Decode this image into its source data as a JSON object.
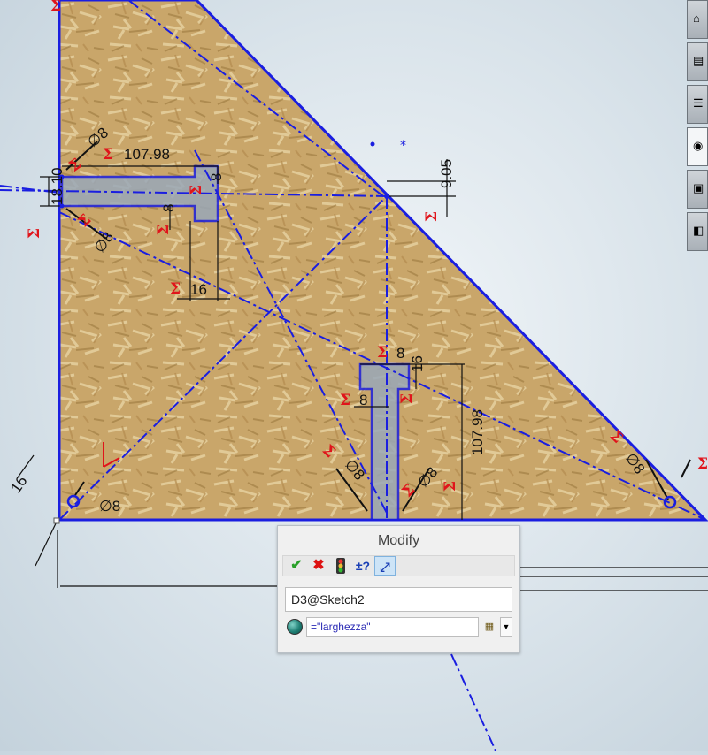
{
  "sketch": {
    "dimensions": {
      "dia_top_left": "∅8",
      "horizontal_top": "107.98",
      "slot_top_height": "8",
      "vertical_left": "18.10",
      "slot_left_height": "8",
      "dia_left_mid": "∅8",
      "slot_width_mid": "16",
      "right_offset": "9.05",
      "slot_center_width": "8",
      "slot_center_height": "16",
      "slot_center_left": "8",
      "dia_center_left": "∅8",
      "dia_center_right": "∅8",
      "vertical_right": "107.98",
      "dia_bottom_left": "∅8",
      "bottom_left_offset": "16",
      "dia_bottom_right": "∅8"
    },
    "equation_symbol": "Σ"
  },
  "modify_dialog": {
    "title": "Modify",
    "name_value": "D3@Sketch2",
    "expression_value": "=\"larghezza\""
  },
  "colors": {
    "sketch_blue": "#1a1ee0",
    "equation_red": "#e0141b",
    "wood": "#c9a66a"
  }
}
